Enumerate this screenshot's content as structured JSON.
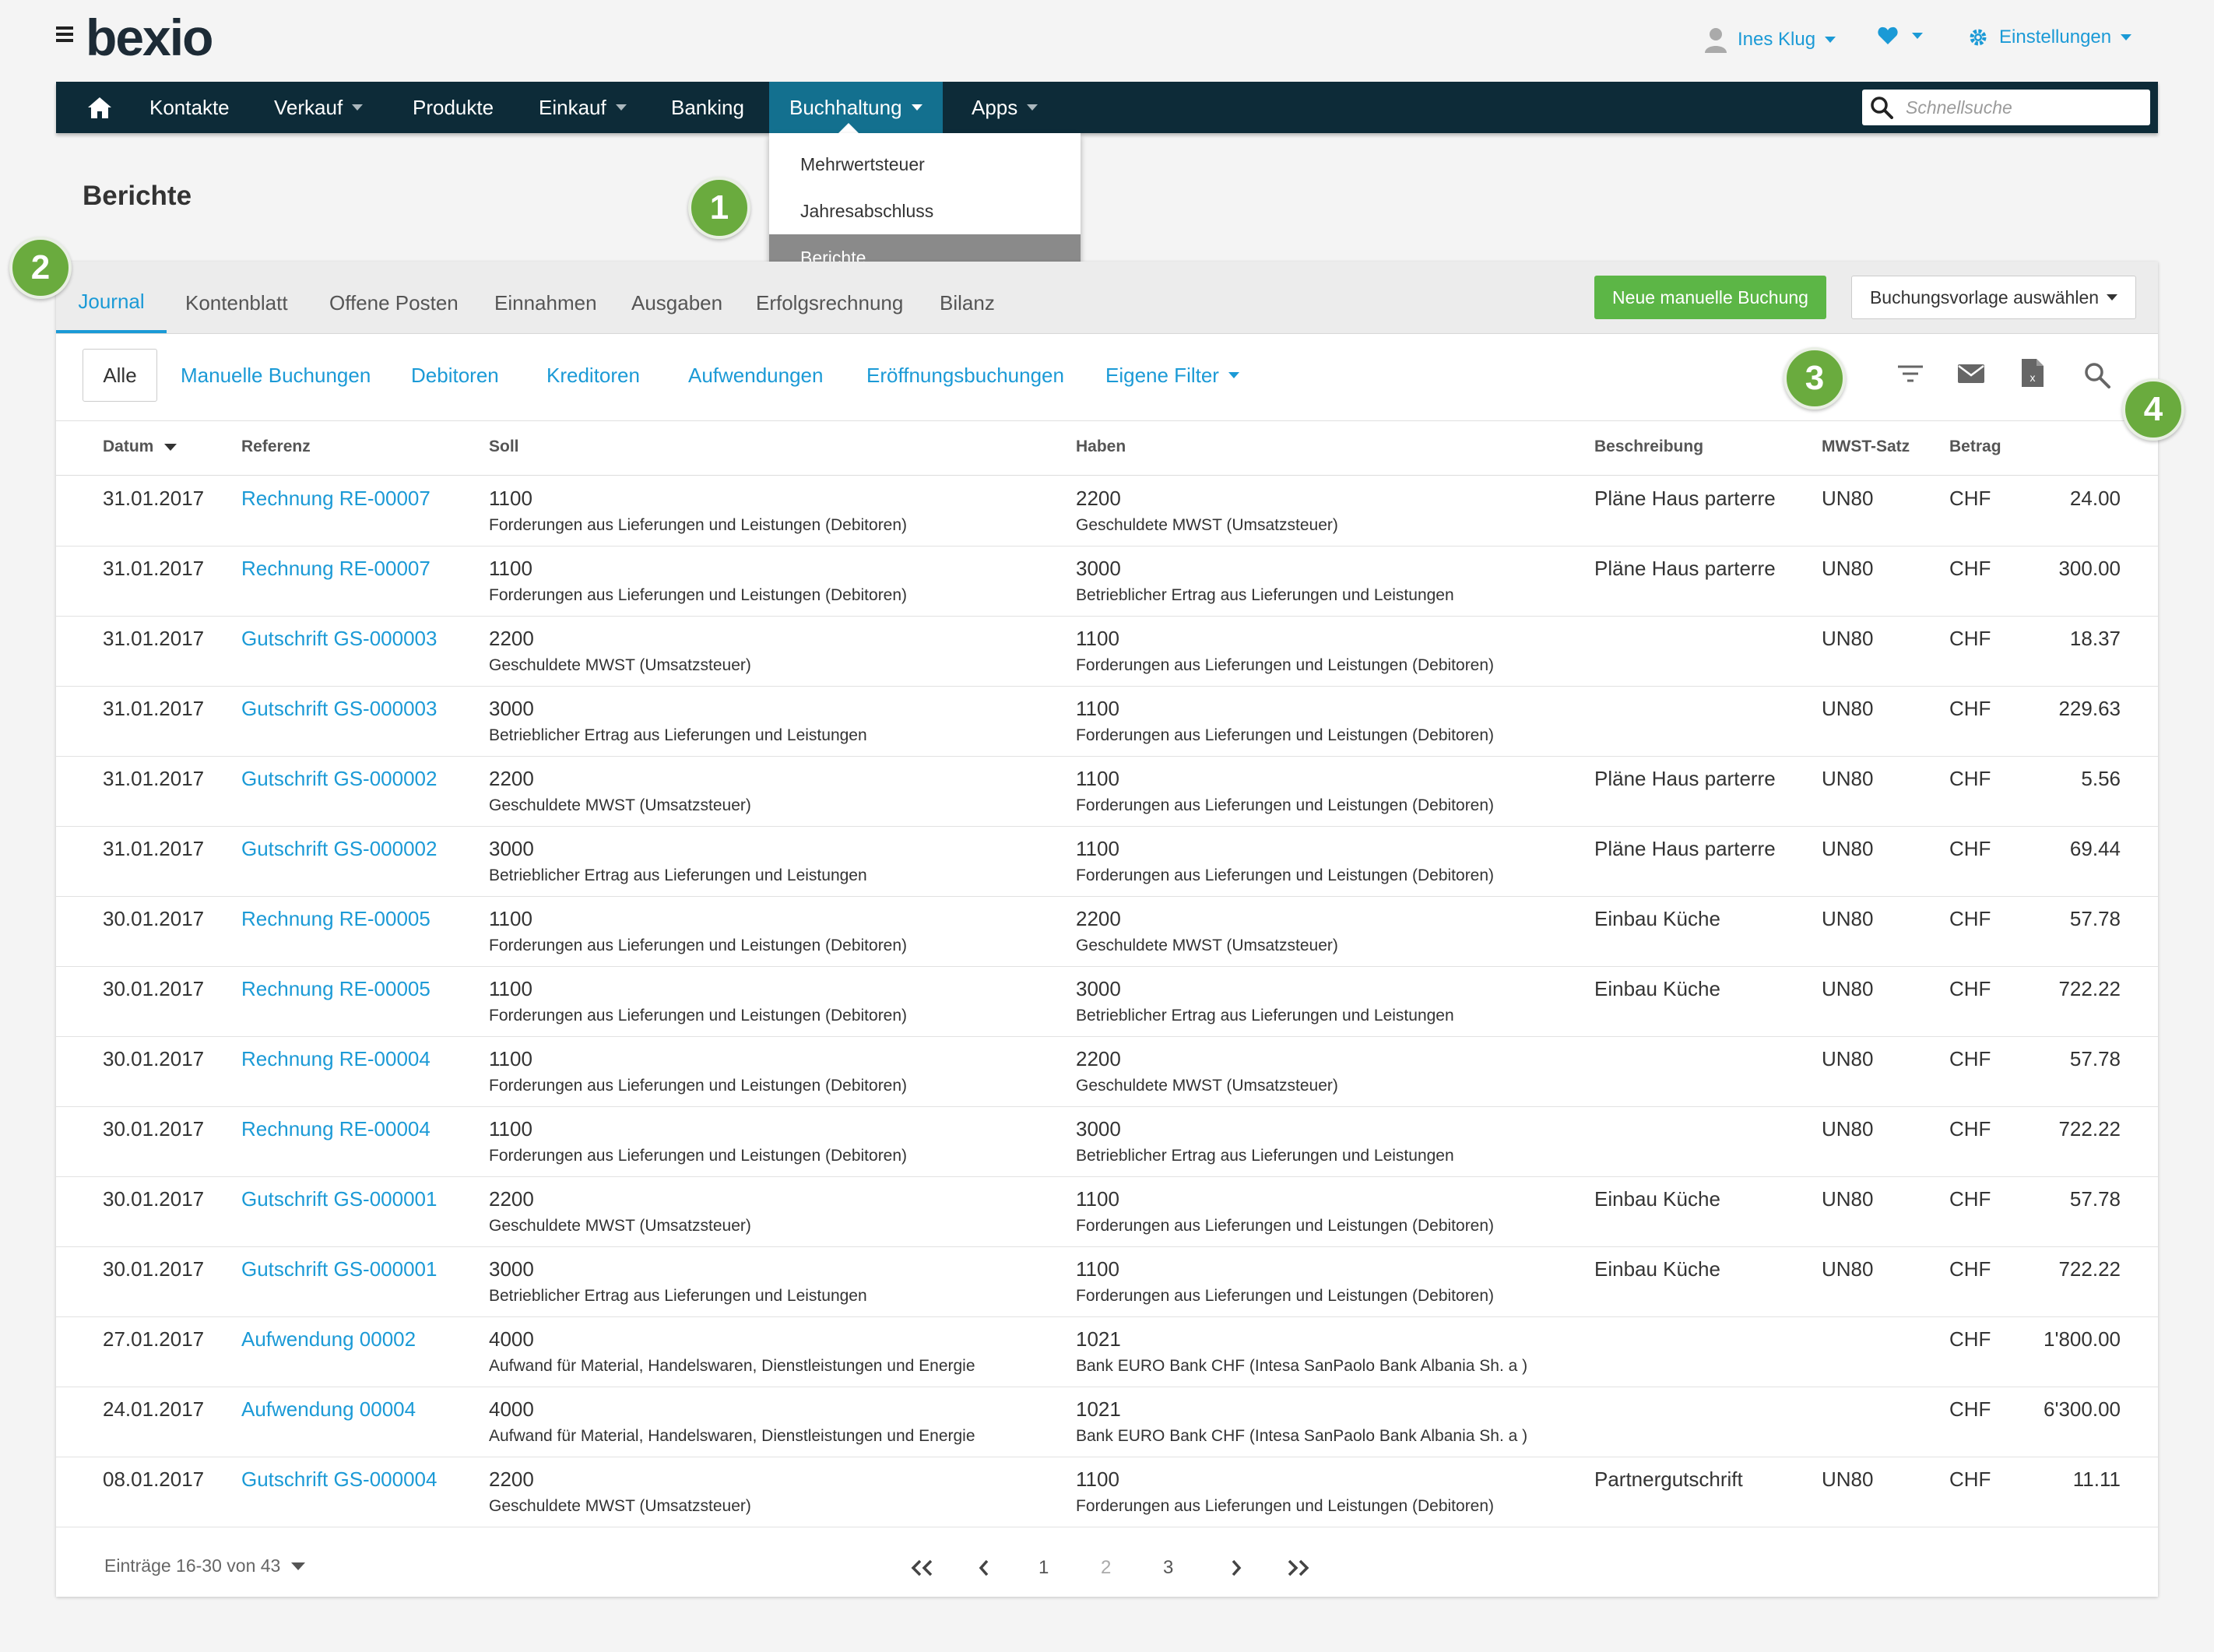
{
  "header": {
    "logo": "bexio",
    "user_name": "Ines Klug",
    "settings_label": "Einstellungen"
  },
  "nav": {
    "items": [
      {
        "label": "Kontakte"
      },
      {
        "label": "Verkauf"
      },
      {
        "label": "Produkte"
      },
      {
        "label": "Einkauf"
      },
      {
        "label": "Banking"
      },
      {
        "label": "Buchhaltung"
      },
      {
        "label": "Apps"
      }
    ],
    "search_placeholder": "Schnellsuche"
  },
  "dropdown": {
    "items": [
      "Mehrwertsteuer",
      "Jahresabschluss",
      "Berichte"
    ],
    "active": "Berichte"
  },
  "page_title": "Berichte",
  "badges": [
    "1",
    "2",
    "3",
    "4"
  ],
  "tabs": [
    "Journal",
    "Kontenblatt",
    "Offene Posten",
    "Einnahmen",
    "Ausgaben",
    "Erfolgsrechnung",
    "Bilanz"
  ],
  "actions": {
    "new_booking": "Neue manuelle Buchung",
    "template": "Buchungsvorlage auswählen"
  },
  "filters": [
    "Alle",
    "Manuelle Buchungen",
    "Debitoren",
    "Kreditoren",
    "Aufwendungen",
    "Eröffnungsbuchungen",
    "Eigene Filter"
  ],
  "table": {
    "headers": [
      "Datum",
      "Referenz",
      "Soll",
      "Haben",
      "Beschreibung",
      "MWST-Satz",
      "Betrag"
    ],
    "rows": [
      {
        "date": "31.01.2017",
        "ref": "Rechnung RE-00007",
        "soll_nr": "1100",
        "soll_name": "Forderungen aus Lieferungen und Leistungen (Debitoren)",
        "haben_nr": "2200",
        "haben_name": "Geschuldete MWST (Umsatzsteuer)",
        "desc": "Pläne Haus parterre",
        "vat": "UN80",
        "cur": "CHF",
        "amount": "24.00"
      },
      {
        "date": "31.01.2017",
        "ref": "Rechnung RE-00007",
        "soll_nr": "1100",
        "soll_name": "Forderungen aus Lieferungen und Leistungen (Debitoren)",
        "haben_nr": "3000",
        "haben_name": "Betrieblicher Ertrag aus Lieferungen und Leistungen",
        "desc": "Pläne Haus parterre",
        "vat": "UN80",
        "cur": "CHF",
        "amount": "300.00"
      },
      {
        "date": "31.01.2017",
        "ref": "Gutschrift GS-000003",
        "soll_nr": "2200",
        "soll_name": "Geschuldete MWST (Umsatzsteuer)",
        "haben_nr": "1100",
        "haben_name": "Forderungen aus Lieferungen und Leistungen (Debitoren)",
        "desc": "",
        "vat": "UN80",
        "cur": "CHF",
        "amount": "18.37"
      },
      {
        "date": "31.01.2017",
        "ref": "Gutschrift GS-000003",
        "soll_nr": "3000",
        "soll_name": "Betrieblicher Ertrag aus Lieferungen und Leistungen",
        "haben_nr": "1100",
        "haben_name": "Forderungen aus Lieferungen und Leistungen (Debitoren)",
        "desc": "",
        "vat": "UN80",
        "cur": "CHF",
        "amount": "229.63"
      },
      {
        "date": "31.01.2017",
        "ref": "Gutschrift GS-000002",
        "soll_nr": "2200",
        "soll_name": "Geschuldete MWST (Umsatzsteuer)",
        "haben_nr": "1100",
        "haben_name": "Forderungen aus Lieferungen und Leistungen (Debitoren)",
        "desc": "Pläne Haus parterre",
        "vat": "UN80",
        "cur": "CHF",
        "amount": "5.56"
      },
      {
        "date": "31.01.2017",
        "ref": "Gutschrift GS-000002",
        "soll_nr": "3000",
        "soll_name": "Betrieblicher Ertrag aus Lieferungen und Leistungen",
        "haben_nr": "1100",
        "haben_name": "Forderungen aus Lieferungen und Leistungen (Debitoren)",
        "desc": "Pläne Haus parterre",
        "vat": "UN80",
        "cur": "CHF",
        "amount": "69.44"
      },
      {
        "date": "30.01.2017",
        "ref": "Rechnung RE-00005",
        "soll_nr": "1100",
        "soll_name": "Forderungen aus Lieferungen und Leistungen (Debitoren)",
        "haben_nr": "2200",
        "haben_name": "Geschuldete MWST (Umsatzsteuer)",
        "desc": "Einbau Küche",
        "vat": "UN80",
        "cur": "CHF",
        "amount": "57.78"
      },
      {
        "date": "30.01.2017",
        "ref": "Rechnung RE-00005",
        "soll_nr": "1100",
        "soll_name": "Forderungen aus Lieferungen und Leistungen (Debitoren)",
        "haben_nr": "3000",
        "haben_name": "Betrieblicher Ertrag aus Lieferungen und Leistungen",
        "desc": "Einbau Küche",
        "vat": "UN80",
        "cur": "CHF",
        "amount": "722.22"
      },
      {
        "date": "30.01.2017",
        "ref": "Rechnung RE-00004",
        "soll_nr": "1100",
        "soll_name": "Forderungen aus Lieferungen und Leistungen (Debitoren)",
        "haben_nr": "2200",
        "haben_name": "Geschuldete MWST (Umsatzsteuer)",
        "desc": "",
        "vat": "UN80",
        "cur": "CHF",
        "amount": "57.78"
      },
      {
        "date": "30.01.2017",
        "ref": "Rechnung RE-00004",
        "soll_nr": "1100",
        "soll_name": "Forderungen aus Lieferungen und Leistungen (Debitoren)",
        "haben_nr": "3000",
        "haben_name": "Betrieblicher Ertrag aus Lieferungen und Leistungen",
        "desc": "",
        "vat": "UN80",
        "cur": "CHF",
        "amount": "722.22"
      },
      {
        "date": "30.01.2017",
        "ref": "Gutschrift GS-000001",
        "soll_nr": "2200",
        "soll_name": "Geschuldete MWST (Umsatzsteuer)",
        "haben_nr": "1100",
        "haben_name": "Forderungen aus Lieferungen und Leistungen (Debitoren)",
        "desc": "Einbau Küche",
        "vat": "UN80",
        "cur": "CHF",
        "amount": "57.78"
      },
      {
        "date": "30.01.2017",
        "ref": "Gutschrift GS-000001",
        "soll_nr": "3000",
        "soll_name": "Betrieblicher Ertrag aus Lieferungen und Leistungen",
        "haben_nr": "1100",
        "haben_name": "Forderungen aus Lieferungen und Leistungen (Debitoren)",
        "desc": "Einbau Küche",
        "vat": "UN80",
        "cur": "CHF",
        "amount": "722.22"
      },
      {
        "date": "27.01.2017",
        "ref": "Aufwendung 00002",
        "soll_nr": "4000",
        "soll_name": "Aufwand für Material, Handelswaren, Dienstleistungen und Energie",
        "haben_nr": "1021",
        "haben_name": "Bank EURO Bank CHF (Intesa SanPaolo Bank Albania Sh. a )",
        "desc": "",
        "vat": "",
        "cur": "CHF",
        "amount": "1'800.00"
      },
      {
        "date": "24.01.2017",
        "ref": "Aufwendung 00004",
        "soll_nr": "4000",
        "soll_name": "Aufwand für Material, Handelswaren, Dienstleistungen und Energie",
        "haben_nr": "1021",
        "haben_name": "Bank EURO Bank CHF (Intesa SanPaolo Bank Albania Sh. a )",
        "desc": "",
        "vat": "",
        "cur": "CHF",
        "amount": "6'300.00"
      },
      {
        "date": "08.01.2017",
        "ref": "Gutschrift GS-000004",
        "soll_nr": "2200",
        "soll_name": "Geschuldete MWST (Umsatzsteuer)",
        "haben_nr": "1100",
        "haben_name": "Forderungen aus Lieferungen und Leistungen (Debitoren)",
        "desc": "Partnergutschrift",
        "vat": "UN80",
        "cur": "CHF",
        "amount": "11.11"
      }
    ]
  },
  "pagination": {
    "entries_label": "Einträge 16-30 von 43",
    "pages": [
      "1",
      "2",
      "3"
    ],
    "current_page": "2"
  },
  "colors": {
    "nav_bg": "#0d2b38",
    "nav_active": "#13708f",
    "link": "#1b9ad6",
    "green": "#5cb646",
    "badge": "#6aab3e"
  }
}
